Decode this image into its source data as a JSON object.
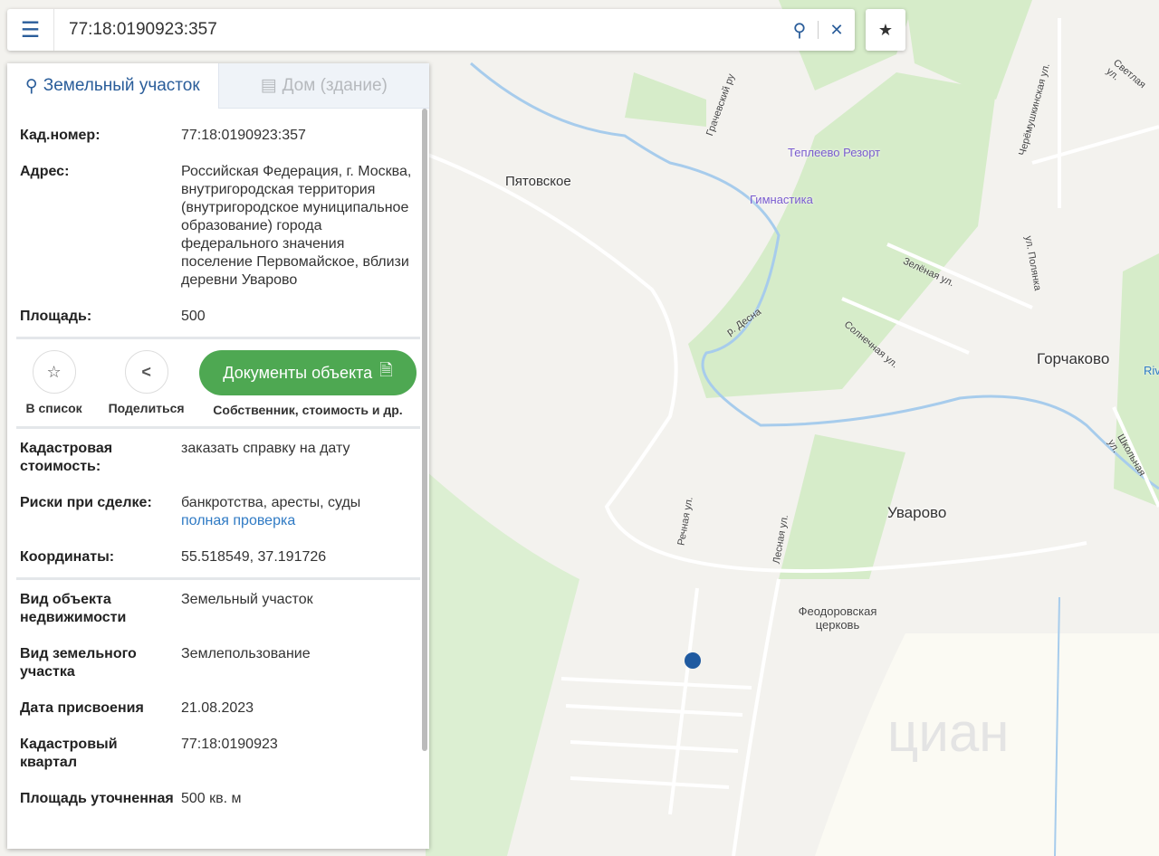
{
  "search": {
    "value": "77:18:0190923:357",
    "menu_icon": "menu-icon",
    "search_icon": "search-icon",
    "clear_icon": "close-icon",
    "favorite_icon": "star-icon"
  },
  "tabs": [
    {
      "label": "Земельный участок",
      "icon": "map-pin-icon"
    },
    {
      "label": "Дом (здание)",
      "icon": "building-icon"
    }
  ],
  "info1": [
    {
      "key": "Кад.номер:",
      "value": "77:18:0190923:357",
      "link": true
    },
    {
      "key": "Адрес:",
      "value": "Российская Федерация, г. Москва, внутригородская территория (внутригородское муниципальное образование) города федерального значения поселение Первомайское, вблизи деревни Уварово"
    },
    {
      "key": "Площадь:",
      "value": "500"
    }
  ],
  "actions": {
    "list_label": "В список",
    "share_label": "Поделиться",
    "docs_button": "Документы объекта",
    "docs_caption": "Собственник, стоимость и др."
  },
  "info2": {
    "cost_key": "Кадастровая стоимость:",
    "cost_link": "заказать справку на дату",
    "risk_key": "Риски при сделке:",
    "risk_value": "банкротства, аресты, суды",
    "risk_link": "полная проверка",
    "coord_key": "Координаты:",
    "coord_value": "55.518549, 37.191726"
  },
  "info3": [
    {
      "key": "Вид объекта недвижимости",
      "value": "Земельный участок"
    },
    {
      "key": "Вид земельного участка",
      "value": "Землепользование"
    },
    {
      "key": "Дата присвоения",
      "value": "21.08.2023"
    },
    {
      "key": "Кадастровый квартал",
      "value": "77:18:0190923"
    },
    {
      "key": "Площадь уточненная",
      "value": "500 кв. м"
    }
  ],
  "map": {
    "places": [
      "Пятовское",
      "Горчаково",
      "Уварово"
    ],
    "pois": [
      "Теплеево Резорт",
      "Гимнастика",
      "Феодоровская церковь"
    ],
    "streets": [
      "Грачевский ру",
      "р. Десна",
      "Зелёная ул.",
      "ул. Полянка",
      "Черёмушкинская ул.",
      "Светлая ул.",
      "Солнечная ул.",
      "Школьная ул.",
      "Речная ул.",
      "Лесная ул.",
      "Riv"
    ],
    "watermark": "циан",
    "marker_color": "#1f5aa0"
  }
}
